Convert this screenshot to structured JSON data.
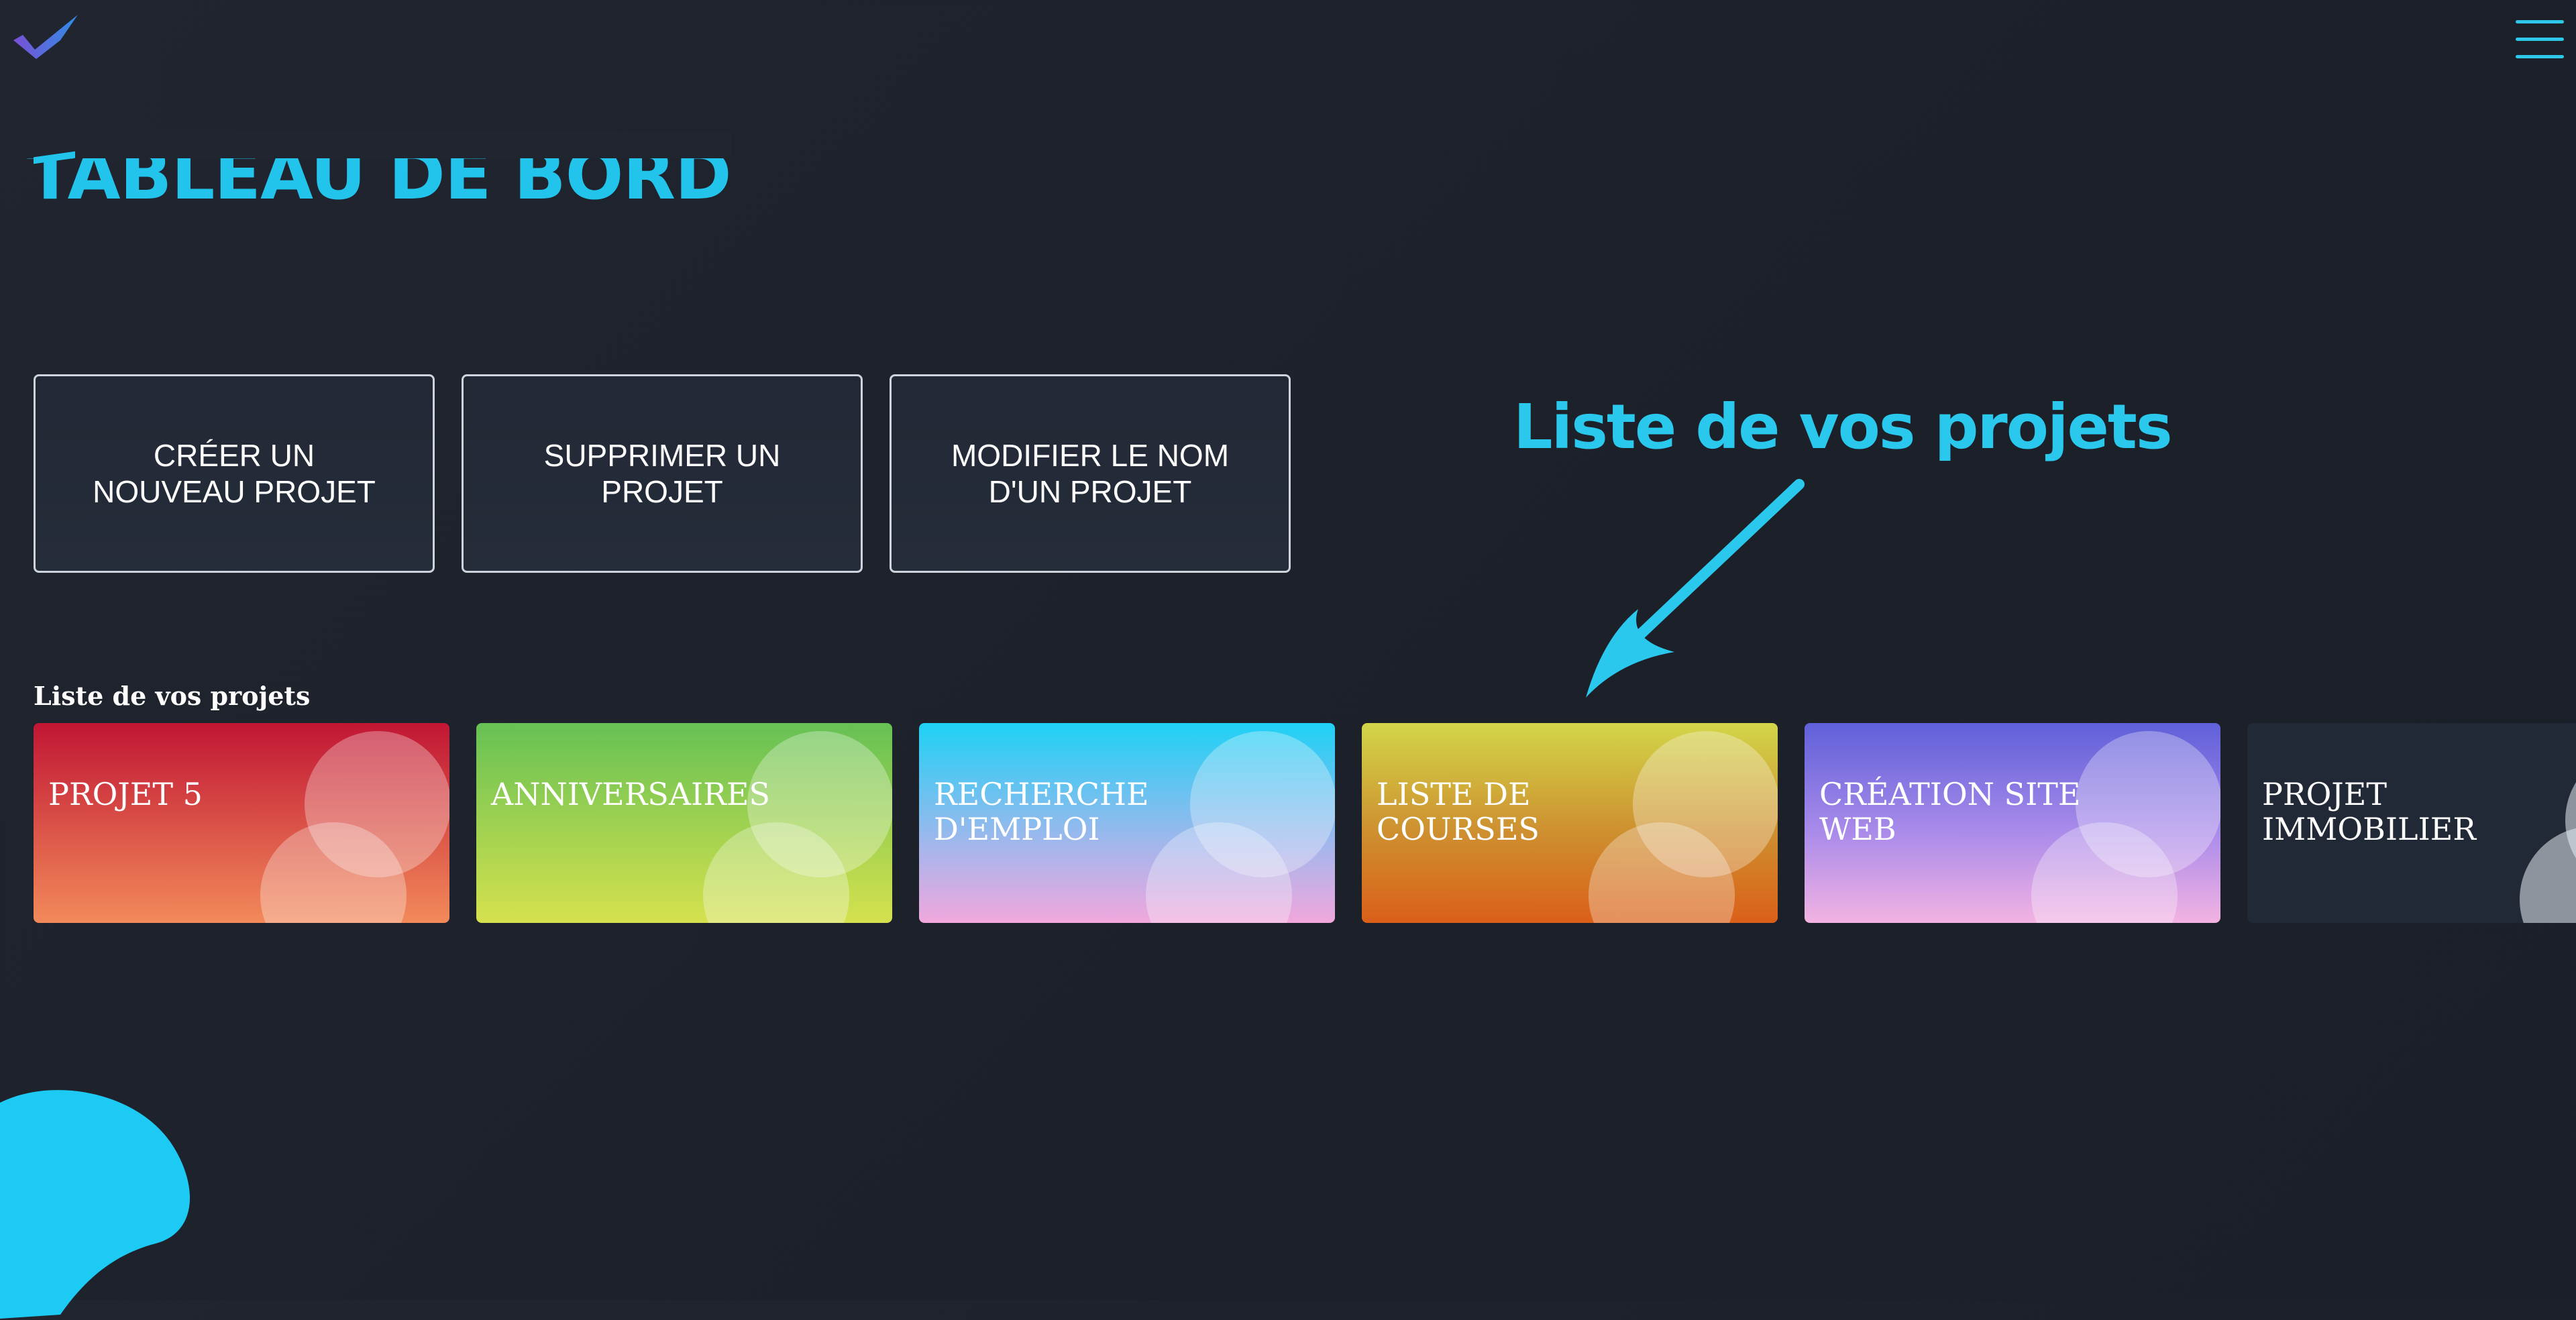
{
  "header": {
    "logo_icon": "checkmark-icon",
    "menu_icon": "hamburger-menu-icon"
  },
  "page": {
    "title": "TABLEAU DE BORD"
  },
  "actions": {
    "create_label": "CRÉER UN NOUVEAU PROJET",
    "delete_label": "SUPPRIMER UN PROJET",
    "rename_label": "MODIFIER LE NOM D'UN PROJET"
  },
  "annotation": {
    "text": "Liste de vos projets",
    "icon": "arrow-down-left-icon"
  },
  "projects": {
    "label": "Liste de vos projets",
    "items": [
      {
        "label": "PROJET 5"
      },
      {
        "label": "ANNIVERSAIRES"
      },
      {
        "label": "RECHERCHE D'EMPLOI"
      },
      {
        "label": "LISTE DE COURSES"
      },
      {
        "label": "CRÉATION SITE WEB"
      },
      {
        "label": "PROJET IMMOBILIER"
      }
    ]
  },
  "colors": {
    "background": "#1f2430",
    "accent": "#22c4ec",
    "card_red": "#c11634",
    "card_green": "#66c154",
    "card_blue": "#1ed1f5",
    "card_yellow": "#d2d649",
    "card_purple": "#5f60d9",
    "card_dark": "#222936"
  }
}
